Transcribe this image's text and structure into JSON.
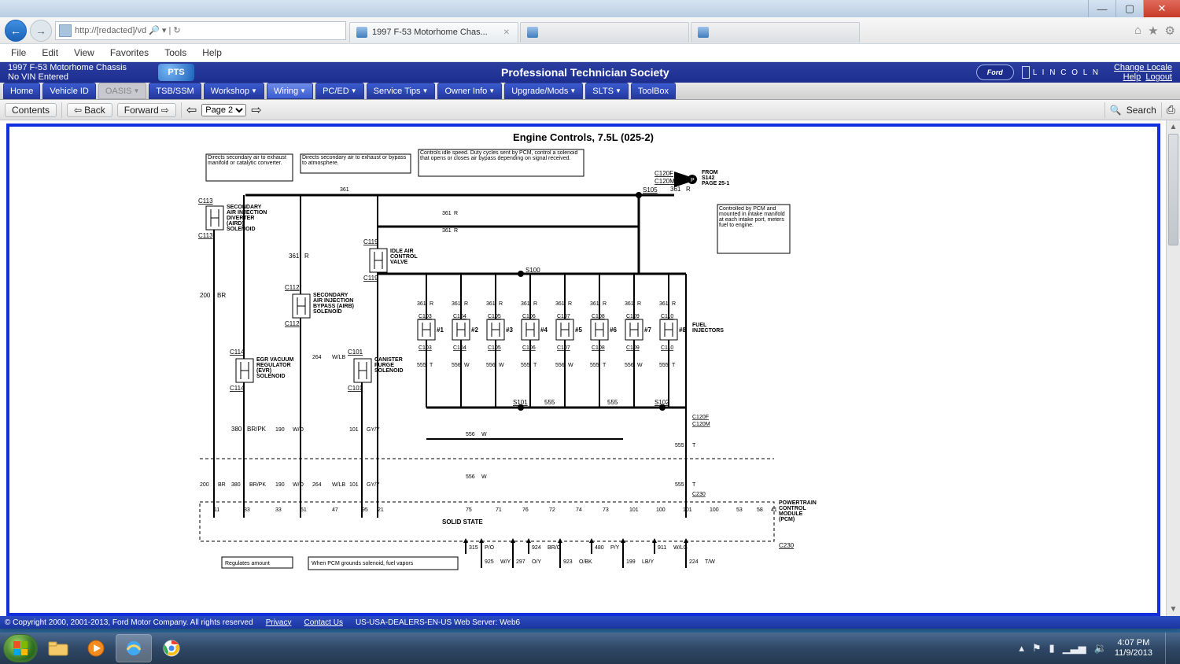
{
  "window": {
    "min": "—",
    "max": "▢",
    "close": "✕"
  },
  "ie": {
    "url": "http://[redacted]/vd  🔎 ▾ | ↻",
    "tabs": [
      {
        "label": "1997 F-53 Motorhome Chas...",
        "active": true,
        "x": "✕"
      },
      {
        "label": "",
        "active": false,
        "x": ""
      },
      {
        "label": "",
        "active": false,
        "x": ""
      }
    ],
    "home_icon": "⌂",
    "star_icon": "★",
    "gear_icon": "⚙"
  },
  "menubar": [
    "File",
    "Edit",
    "View",
    "Favorites",
    "Tools",
    "Help"
  ],
  "pts": {
    "vehicle_line1": "1997 F-53 Motorhome Chassis",
    "vehicle_line2": "No VIN Entered",
    "logo": "PTS",
    "title": "Professional Technician Society",
    "brand_ford": "Ford",
    "brand_lincoln": "L I N C O L N",
    "links": {
      "change": "Change Locale",
      "help": "Help",
      "logout": "Logout"
    }
  },
  "toolbar": [
    {
      "label": "Home",
      "dd": false
    },
    {
      "label": "Vehicle ID",
      "dd": false
    },
    {
      "label": "OASIS",
      "dd": true,
      "disabled": true
    },
    {
      "label": "TSB/SSM",
      "dd": false
    },
    {
      "label": "Workshop",
      "dd": true
    },
    {
      "label": "Wiring",
      "dd": true,
      "active": true
    },
    {
      "label": "PC/ED",
      "dd": true
    },
    {
      "label": "Service Tips",
      "dd": true
    },
    {
      "label": "Owner Info",
      "dd": true
    },
    {
      "label": "Upgrade/Mods",
      "dd": true
    },
    {
      "label": "SLTS",
      "dd": true
    },
    {
      "label": "ToolBox",
      "dd": false
    }
  ],
  "nav2": {
    "contents": "Contents",
    "back": "Back",
    "forward": "Forward",
    "page_options": [
      "Page 2"
    ],
    "page_selected": "Page 2",
    "search": "Search",
    "print": "⎙"
  },
  "diagram": {
    "title": "Engine Controls, 7.5L (025-2)",
    "callouts": {
      "a": "Directs secondary air to exhaust manifold or catalytic converter.",
      "b": "Directs secondary air to exhaust or bypass to atmosphere.",
      "c": "Controls idle speed. Duty cycles sent by PCM, control a solenoid that opens or closes air bypass depending on signal received.",
      "d": "Controlled by PCM and mounted in intake manifold at each intake port, meters fuel to engine.",
      "e": "Regulates amount",
      "f": "When PCM grounds solenoid, fuel vapors",
      "from": "FROM\nS142\nPAGE 25-1"
    },
    "components": {
      "aird": "SECONDARY\nAIR INJECTION\nDIVERTER\n(AIRD)\nSOLENOID",
      "airb": "SECONDARY\nAIR INJECTION\nBYPASS (AIRB)\nSOLENOID",
      "iac": "IDLE AIR\nCONTROL\nVALVE",
      "evr": "EGR VACUUM\nREGULATOR\n(EVR)\nSOLENOID",
      "cps": "CANISTER\nPURGE\nSOLENOID",
      "inj": "FUEL\nINJECTORS",
      "pcm": "POWERTRAIN\nCONTROL\nMODULE\n(PCM)",
      "solid": "SOLID STATE"
    },
    "connectors": {
      "c113": "C113",
      "c112": "C112",
      "c114": "C114",
      "c119": "C119",
      "c101": "C101",
      "c103": "C103",
      "c104": "C104",
      "c105": "C105",
      "c106": "C106",
      "c107": "C107",
      "c108": "C108",
      "c109": "C109",
      "c110": "C110",
      "c120f": "C120F",
      "c120m": "C120M",
      "c230": "C230",
      "s100": "S100",
      "s101": "S101",
      "s102": "S102",
      "s105": "S105"
    },
    "inj_nums": [
      "#1",
      "#2",
      "#3",
      "#4",
      "#5",
      "#6",
      "#7",
      "#8"
    ],
    "wires": {
      "w361": "361",
      "wR": "R",
      "w200": "200",
      "wBR": "BR",
      "w380": "380",
      "wBRPK": "BR/PK",
      "w190": "190",
      "wWO": "W/O",
      "w264": "264",
      "wWLB": "W/LB",
      "w101": "101",
      "wGYY": "GY/Y",
      "w555": "555",
      "wT": "T",
      "w556": "556",
      "wW": "W",
      "w925": "925",
      "wWY": "W/Y",
      "w297": "297",
      "wOY": "O/Y",
      "w924": "924",
      "wBRO": "BR/O",
      "w923": "923",
      "wOBK": "O/BK",
      "w480": "480",
      "wPY": "P/Y",
      "w199": "199",
      "wLBY": "LB/Y",
      "w911": "911",
      "wWLG": "W/LG",
      "w224": "224",
      "wTW": "T/W",
      "w315": "315",
      "wPO": "P/O"
    },
    "pcm_pins": [
      "11",
      "33",
      "33",
      "51",
      "47",
      "95",
      "21",
      "",
      "75",
      "71",
      "76",
      "72",
      "74",
      "73",
      "101",
      "100",
      "101",
      "100",
      "53",
      "58",
      "41"
    ]
  },
  "footer": {
    "copyright": "© Copyright 2000, 2001-2013, Ford Motor Company. All rights reserved",
    "privacy": "Privacy",
    "contact": "Contact Us",
    "server": "US-USA-DEALERS-EN-US    Web Server: Web6"
  },
  "taskbar": {
    "time": "4:07 PM",
    "date": "11/9/2013",
    "tray_up": "▴",
    "tray_flag": "⚑",
    "tray_batt": "▮",
    "tray_net": "▁▃▅",
    "tray_vol": "🔉"
  }
}
